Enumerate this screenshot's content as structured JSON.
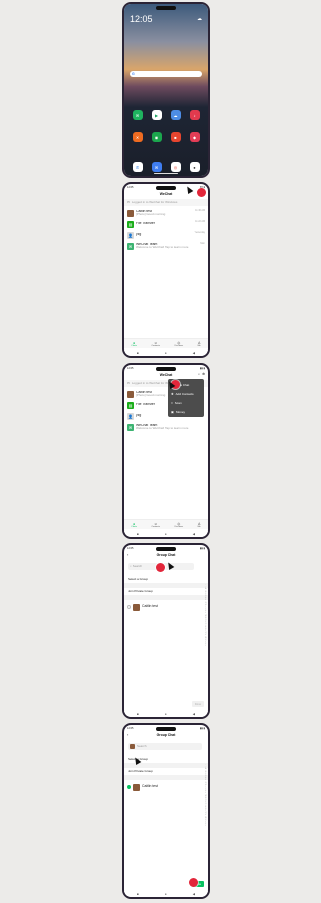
{
  "home": {
    "time": "12:05",
    "date": "Thu, 23 Jun",
    "weather_icon": "cloud-icon",
    "search_logo": "G",
    "apps_row1": [
      {
        "label": "WeChat",
        "color": "#1fb35f",
        "glyph": "✉"
      },
      {
        "label": "Play Store",
        "color": "#ffffff",
        "glyph": "▶"
      },
      {
        "label": "Weather",
        "color": "#4d8de6",
        "glyph": "☁"
      },
      {
        "label": "Music",
        "color": "#e23a4e",
        "glyph": "♪"
      }
    ],
    "apps_row2": [
      {
        "label": "Mi Remote",
        "color": "#ee6b21",
        "glyph": "✕"
      },
      {
        "label": "Security",
        "color": "#1ba64d",
        "glyph": "◉"
      },
      {
        "label": "Screen Recorder",
        "color": "#e7452f",
        "glyph": "■"
      },
      {
        "label": "Themes",
        "color": "#e33d56",
        "glyph": "◆"
      }
    ],
    "dock": [
      {
        "color": "#ffffff",
        "glyph": "✆"
      },
      {
        "color": "#3f7df0",
        "glyph": "✉"
      },
      {
        "color": "#ffffff",
        "glyph": "◎"
      },
      {
        "color": "#ffffff",
        "glyph": "●"
      }
    ]
  },
  "wechat": {
    "title": "WeChat",
    "status_left": "12:05",
    "status_right": "▮▮ ▮",
    "banner": "Logged in to WeChat for Windows",
    "rows": [
      {
        "name": "Caitlin test",
        "sub": "[Photo] Good morning",
        "time": "11:46 AM",
        "avatar": "#8a5a3a"
      },
      {
        "name": "File Transfer",
        "sub": "",
        "time": "11:22 AM",
        "avatar": "#1aad19"
      },
      {
        "name": "yzg",
        "sub": "",
        "time": "Yesterday",
        "avatar": "#d8d8d8"
      },
      {
        "name": "WeChat Team",
        "sub": "Welcome to WeChat! Tap to learn more",
        "time": "Mon",
        "avatar": "#3cb371"
      }
    ],
    "tabs": [
      "Chats",
      "Contacts",
      "Discover",
      "Me"
    ],
    "menu": [
      {
        "label": "New Chat",
        "icon": "chat-bubble-icon"
      },
      {
        "label": "Add Contacts",
        "icon": "add-user-icon"
      },
      {
        "label": "Scan",
        "icon": "scan-icon"
      },
      {
        "label": "Money",
        "icon": "money-icon"
      }
    ]
  },
  "group": {
    "title": "Group Chat",
    "search_placeholder": "Search",
    "select_group": "Select a Group",
    "join_private": "Join Private Group",
    "contact": "Caitlin test",
    "done": "Done",
    "alphabet": [
      "↑",
      "☆",
      "A",
      "B",
      "C",
      "D",
      "E",
      "F",
      "G",
      "H",
      "I",
      "J",
      "K",
      "L",
      "M",
      "N",
      "O",
      "P",
      "Q",
      "R",
      "S",
      "T",
      "U",
      "V",
      "W",
      "X",
      "Y",
      "Z",
      "#"
    ]
  }
}
